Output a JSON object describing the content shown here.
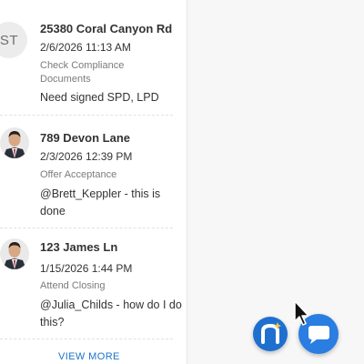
{
  "feed": {
    "items": [
      {
        "avatar_initials": "ST",
        "address": "25380 Coral Canyon Rd",
        "datetime": "2/6/2026 11:13 AM",
        "task": "Check Compliance Documents",
        "comment": "Need signed SPD, LPD"
      },
      {
        "address": "789 Devon Lane",
        "datetime": "2/3/2026 12:39 PM",
        "task": "Offer Acceptance",
        "comment": "@Brett_Keppler - this is done"
      },
      {
        "address": "123 James Ln",
        "datetime": "1/15/2026 1:44 PM",
        "task": "Attend Closing",
        "comment": "@Julia_Childs - how do I do this?"
      }
    ],
    "view_more_label": "VIEW MORE"
  },
  "fab": {
    "brand_icon": "n-logo-icon",
    "chat_icon": "chat-bubble-icon"
  },
  "colors": {
    "accent": "#1f6fd1",
    "link": "#1a73c9"
  }
}
